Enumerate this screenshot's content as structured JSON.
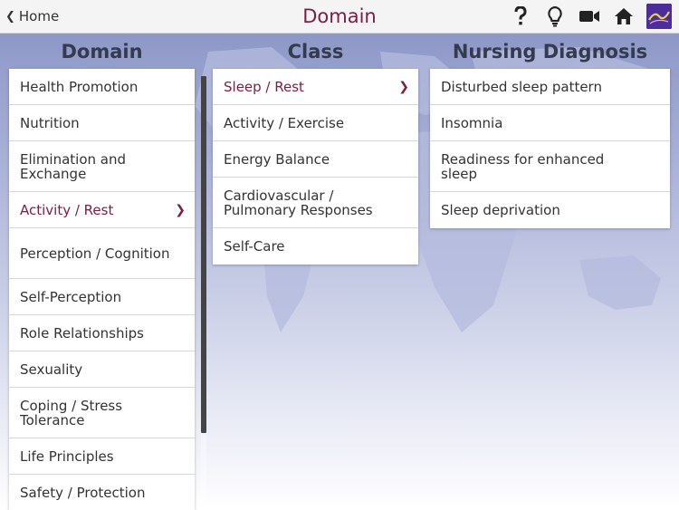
{
  "header": {
    "back_label": "Home",
    "title": "Domain",
    "icons": [
      "help-icon",
      "lightbulb-icon",
      "video-icon",
      "home-icon",
      "app-logo"
    ]
  },
  "columns": {
    "domain_title": "Domain",
    "class_title": "Class",
    "diagnosis_title": "Nursing Diagnosis"
  },
  "domains": [
    "Health Promotion",
    "Nutrition",
    "Elimination and Exchange",
    "Activity / Rest",
    "Perception / Cognition",
    "Self-Perception",
    "Role Relationships",
    "Sexuality",
    "Coping / Stress Tolerance",
    "Life Principles",
    "Safety / Protection"
  ],
  "classes": [
    "Sleep / Rest",
    "Activity / Exercise",
    "Energy Balance",
    "Cardiovascular / Pulmonary Responses",
    "Self-Care"
  ],
  "diagnoses": [
    "Disturbed sleep pattern",
    "Insomnia",
    "Readiness for enhanced sleep",
    "Sleep deprivation"
  ],
  "colors": {
    "accent": "#7a2045",
    "heading": "#333b4d"
  }
}
